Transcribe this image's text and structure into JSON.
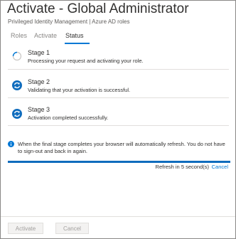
{
  "header": {
    "title": "Activate - Global Administrator",
    "subtitle": "Privileged Identity Management | Azure AD roles"
  },
  "tabs": [
    {
      "label": "Roles",
      "active": false
    },
    {
      "label": "Activate",
      "active": false
    },
    {
      "label": "Status",
      "active": true
    }
  ],
  "stages": [
    {
      "title": "Stage 1",
      "description": "Processing your request and activating your role.",
      "icon": "spinner-icon"
    },
    {
      "title": "Stage 2",
      "description": "Validating that your activation is successful.",
      "icon": "refresh-icon"
    },
    {
      "title": "Stage 3",
      "description": "Activation completed successfully.",
      "icon": "refresh-icon"
    }
  ],
  "info": {
    "icon": "info-icon",
    "text": "When the final stage completes your browser will automatically refresh. You do not have to sign-out and back in again."
  },
  "progress": {
    "percent": 100
  },
  "refresh": {
    "text": "Refresh in 5 second(s)",
    "cancel_label": "Cancel"
  },
  "footer": {
    "activate_label": "Activate",
    "cancel_label": "Cancel"
  },
  "colors": {
    "accent": "#0078d4",
    "icon_blue": "#0f6cbd"
  }
}
